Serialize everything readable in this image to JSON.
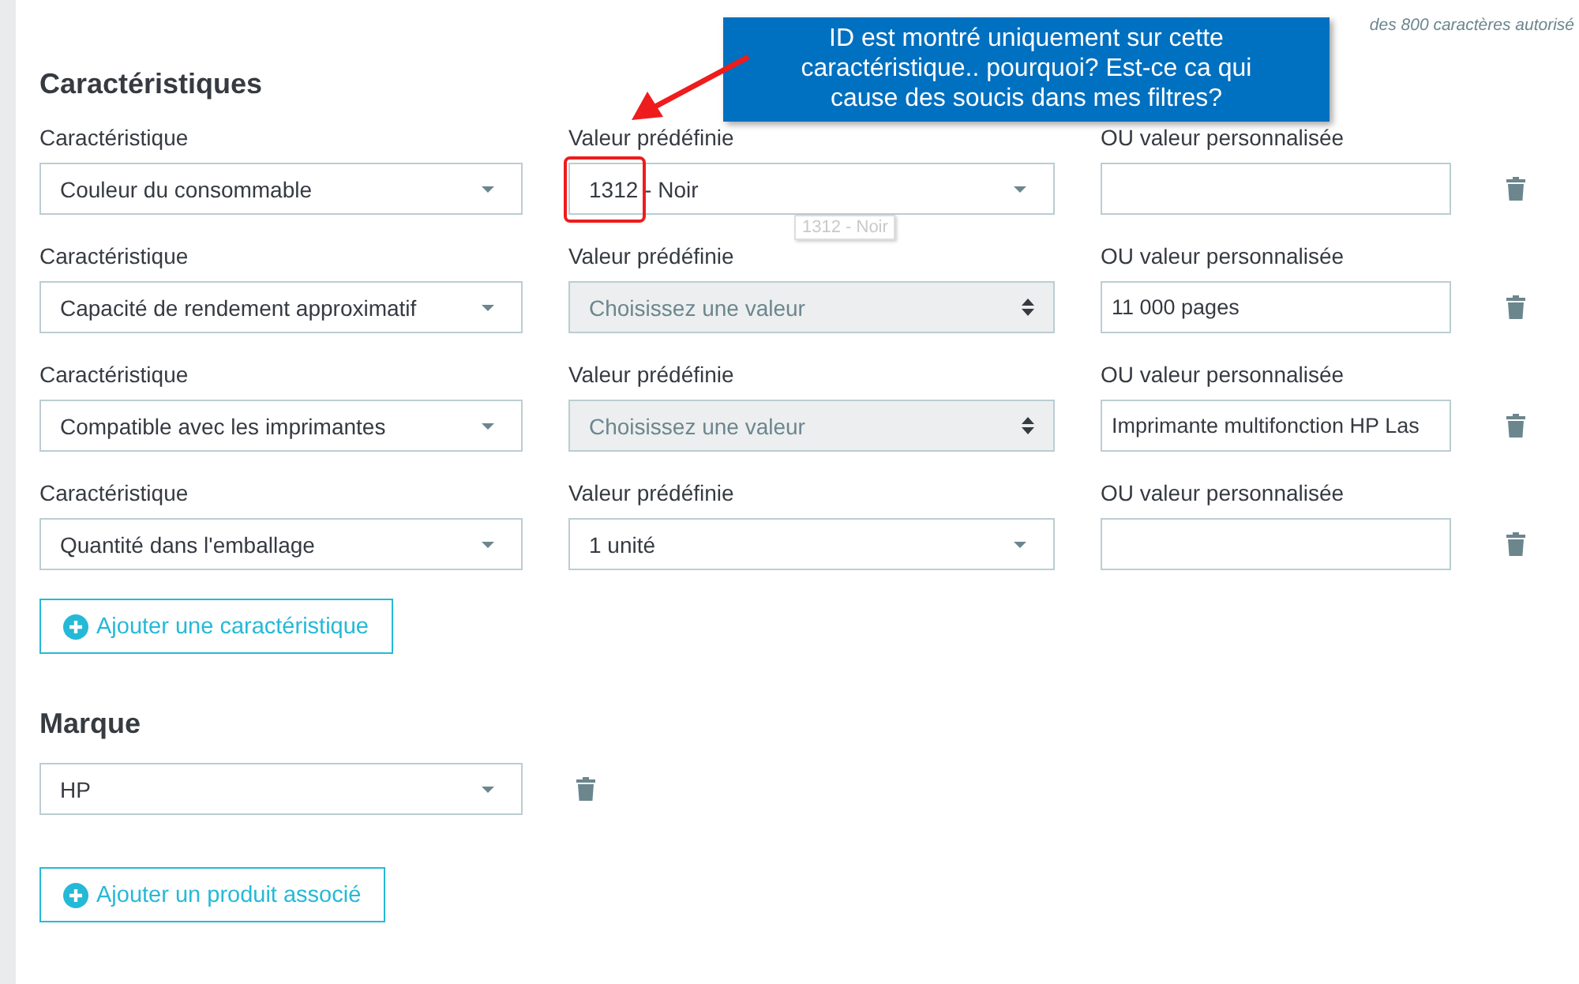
{
  "char_counter": "des 800 caractères autorisé",
  "features": {
    "title": "Caractéristiques",
    "rows": [
      {
        "feature_label": "Caractéristique",
        "feature": "Couleur du consommable",
        "predefined_label": "Valeur prédéfinie",
        "predefined": "1312 - Noir",
        "predefined_disabled": false,
        "custom_label": "OU valeur personnalisée",
        "custom": ""
      },
      {
        "feature_label": "Caractéristique",
        "feature": "Capacité de rendement approximatif",
        "predefined_label": "Valeur prédéfinie",
        "predefined": "Choisissez une valeur",
        "predefined_disabled": true,
        "custom_label": "OU valeur personnalisée",
        "custom": "11 000 pages"
      },
      {
        "feature_label": "Caractéristique",
        "feature": "Compatible avec les imprimantes",
        "predefined_label": "Valeur prédéfinie",
        "predefined": "Choisissez une valeur",
        "predefined_disabled": true,
        "custom_label": "OU valeur personnalisée",
        "custom": "Imprimante multifonction HP Las"
      },
      {
        "feature_label": "Caractéristique",
        "feature": "Quantité dans l'emballage",
        "predefined_label": "Valeur prédéfinie",
        "predefined": "1 unité",
        "predefined_disabled": false,
        "custom_label": "OU valeur personnalisée",
        "custom": ""
      }
    ],
    "add_button": "Ajouter une caractéristique"
  },
  "brand": {
    "title": "Marque",
    "value": "HP"
  },
  "add_related_button": "Ajouter un produit associé",
  "tooltip": "1312 - Noir",
  "annotation": "ID est montré uniquement sur cette caractéristique.. pourquoi? Est-ce ca qui cause des soucis dans mes filtres?"
}
